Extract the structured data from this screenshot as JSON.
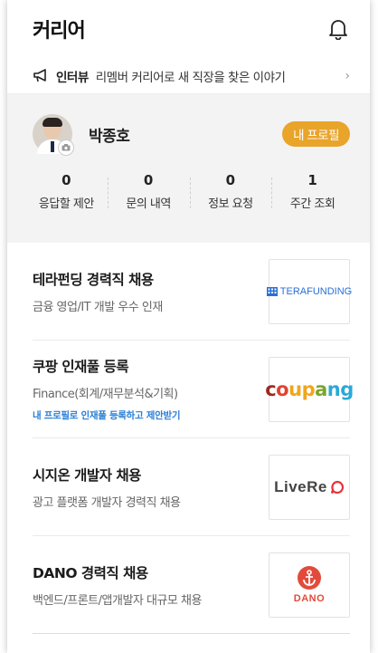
{
  "header": {
    "title": "커리어"
  },
  "notice": {
    "tag": "인터뷰",
    "text": "리멤버 커리어로 새 직장을 찾은 이야기"
  },
  "profile": {
    "name": "박종호",
    "button_label": "내 프로필",
    "stats": [
      {
        "value": "0",
        "label": "응답할 제안"
      },
      {
        "value": "0",
        "label": "문의 내역"
      },
      {
        "value": "0",
        "label": "정보 요청"
      },
      {
        "value": "1",
        "label": "주간 조회"
      }
    ]
  },
  "jobs": [
    {
      "title": "테라펀딩 경력직 채용",
      "subtitle": "금융 영업/IT 개발 우수 인재",
      "logo": "TERAFUNDING"
    },
    {
      "title": "쿠팡 인재풀 등록",
      "subtitle": "Finance(회계/재무분석&기획)",
      "link": "내 프로필로 인재풀 등록하고 제안받기",
      "logo": "coupang"
    },
    {
      "title": "시지온 개발자 채용",
      "subtitle": "광고 플랫폼 개발자 경력직 채용",
      "logo": "LiveRe"
    },
    {
      "title": "DANO 경력직 채용",
      "subtitle": "백엔드/프론트/앱개발자 대규모 채용",
      "logo": "DANO"
    }
  ],
  "colors": {
    "accent": "#e9a42a",
    "link": "#2a7fd6",
    "profile_bg": "#f3f3f3"
  }
}
